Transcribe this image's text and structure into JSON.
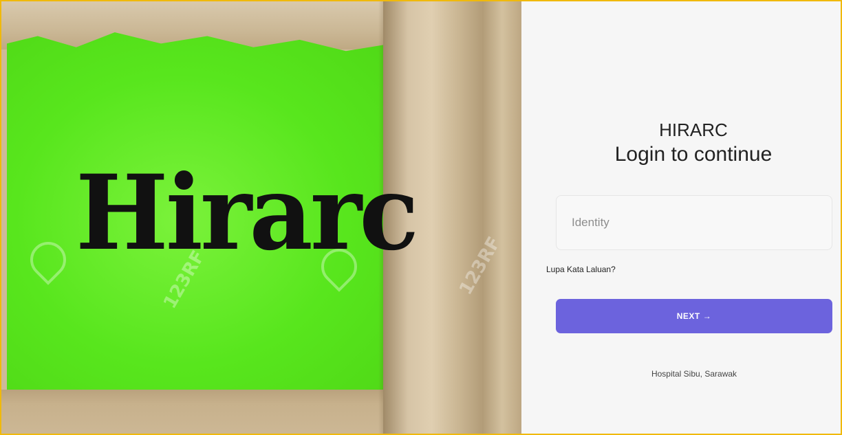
{
  "hero": {
    "word": "Hirarc",
    "watermark": "123RF",
    "colors": {
      "paper": "#58e61d",
      "cardboard": "#cdb99a"
    }
  },
  "login": {
    "app_name": "HIRARC",
    "subtitle": "Login to continue",
    "identity_placeholder": "Identity",
    "identity_value": "",
    "forgot_password_label": "Lupa Kata Laluan?",
    "next_label": "NEXT",
    "next_icon": "arrow-right-icon",
    "footer": "Hospital Sibu, Sarawak"
  },
  "colors": {
    "accent": "#6c63dd",
    "frame": "#f0b90b",
    "panel_bg": "#f6f6f6"
  }
}
